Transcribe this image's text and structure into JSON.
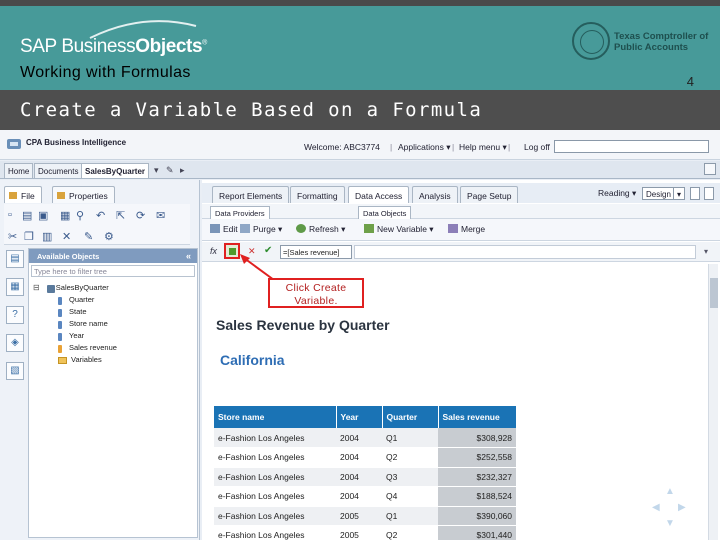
{
  "slide": {
    "logo_prefix": "SAP Business",
    "logo_bold": "Objects",
    "logo_tm": "®",
    "subtitle": "Working with Formulas",
    "comptroller_line1": "Texas Comptroller of",
    "comptroller_line2": "Public Accounts",
    "page_number": "4",
    "title": "Create a Variable Based on a Formula"
  },
  "app_header": {
    "app_name": "CPA Business Intelligence",
    "welcome": "Welcome: ABC3774",
    "applications": "Applications ▾",
    "help_menu": "Help menu ▾",
    "log_off": "Log off"
  },
  "doc_tabs": [
    "Home",
    "Documents",
    "SalesByQuarter"
  ],
  "left_panel": {
    "tabs": [
      "File",
      "Properties"
    ],
    "available_objects": "Available Objects",
    "filter_placeholder": "Type here to filter tree",
    "tree_root": "SalesByQuarter",
    "tree_items": [
      "Quarter",
      "State",
      "Store name",
      "Year",
      "Sales revenue",
      "Variables"
    ]
  },
  "ribbon": {
    "tabs": [
      "Report Elements",
      "Formatting",
      "Data Access",
      "Analysis",
      "Page Setup"
    ],
    "reading": "Reading ▾",
    "design": "Design",
    "design_dd": "▾",
    "subtabs": [
      "Data Providers",
      "Data Objects"
    ],
    "actions": [
      "Edit",
      "Purge ▾",
      "Refresh ▾",
      "New Variable ▾",
      "Merge"
    ]
  },
  "formula_bar": {
    "fx": "fx",
    "value": "=[Sales revenue]"
  },
  "callout": {
    "line1": "Click Create",
    "line2": "Variable."
  },
  "report": {
    "title": "Sales Revenue by Quarter",
    "region": "California",
    "columns": [
      "Store name",
      "Year",
      "Quarter",
      "Sales revenue"
    ],
    "rows": [
      [
        "e-Fashion Los Angeles",
        "2004",
        "Q1",
        "$308,928"
      ],
      [
        "e-Fashion Los Angeles",
        "2004",
        "Q2",
        "$252,558"
      ],
      [
        "e-Fashion Los Angeles",
        "2004",
        "Q3",
        "$232,327"
      ],
      [
        "e-Fashion Los Angeles",
        "2004",
        "Q4",
        "$188,524"
      ],
      [
        "e-Fashion Los Angeles",
        "2005",
        "Q1",
        "$390,060"
      ],
      [
        "e-Fashion Los Angeles",
        "2005",
        "Q2",
        "$301,440"
      ]
    ]
  },
  "colors": {
    "header_teal": "#479a99",
    "title_bar": "#4e4e4e",
    "table_header": "#1a73b5",
    "callout_red": "#e02020"
  }
}
